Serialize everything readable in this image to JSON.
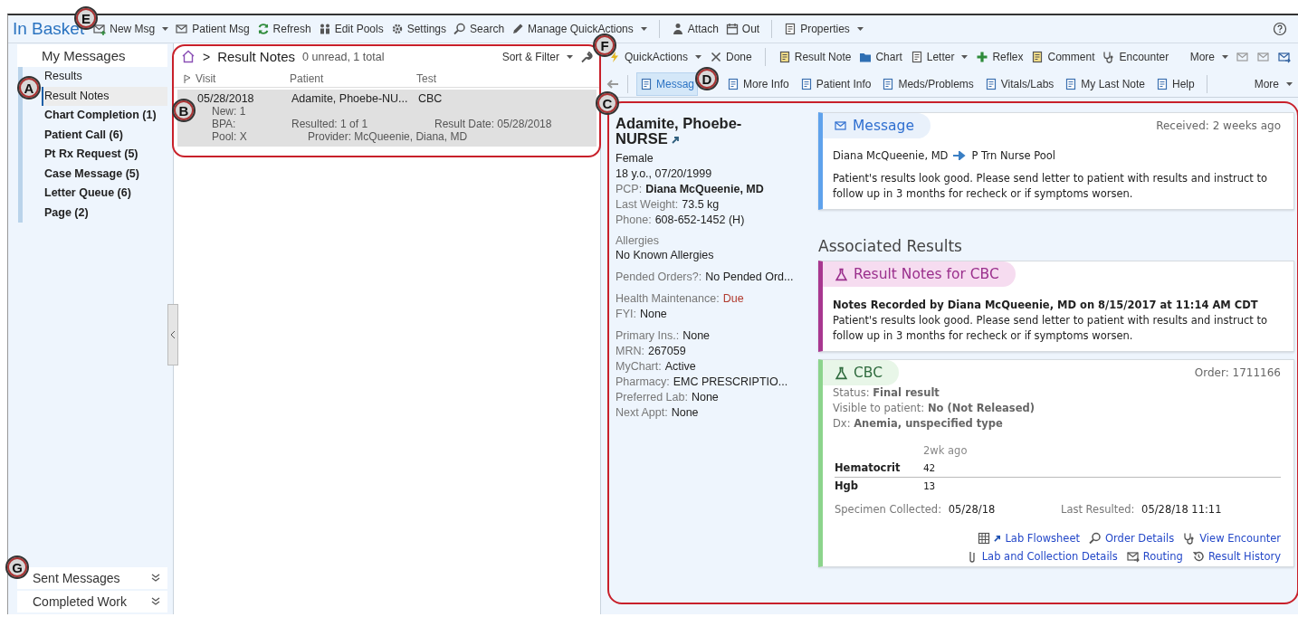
{
  "toolbar": {
    "title": "In Basket",
    "groups": [
      [
        {
          "label": "New Msg",
          "dropdown": true
        },
        {
          "label": "Patient Msg",
          "dropdown": false
        },
        {
          "label": "Refresh",
          "dropdown": false
        },
        {
          "label": "Edit Pools",
          "dropdown": false
        },
        {
          "label": "Settings",
          "dropdown": false
        },
        {
          "label": "Search",
          "dropdown": false
        },
        {
          "label": "Manage QuickActions",
          "dropdown": true
        }
      ],
      [
        {
          "label": "Attach",
          "dropdown": false
        },
        {
          "label": "Out",
          "dropdown": false
        }
      ],
      [
        {
          "label": "Properties",
          "dropdown": true
        }
      ]
    ]
  },
  "sidebar": {
    "title": "My Messages",
    "items": [
      {
        "label": "Results",
        "unread": false,
        "selected": false
      },
      {
        "label": "Result Notes",
        "unread": false,
        "selected": true
      },
      {
        "label": "Chart Completion (1)",
        "unread": true,
        "selected": false
      },
      {
        "label": "Patient Call (6)",
        "unread": true,
        "selected": false
      },
      {
        "label": "Pt Rx Request (5)",
        "unread": true,
        "selected": false
      },
      {
        "label": "Case Message (5)",
        "unread": true,
        "selected": false
      },
      {
        "label": "Letter Queue (6)",
        "unread": true,
        "selected": false
      },
      {
        "label": "Page (2)",
        "unread": true,
        "selected": false
      }
    ],
    "footer": [
      {
        "label": "Sent Messages"
      },
      {
        "label": "Completed Work"
      }
    ]
  },
  "message_list": {
    "separator": ">",
    "folder": "Result Notes",
    "summary": "0 unread, 1 total",
    "sort_filter": "Sort & Filter",
    "columns": [
      "Visit",
      "Patient",
      "Test"
    ],
    "rows": [
      {
        "selected": true,
        "visit": "05/28/2018",
        "patient": "Adamite, Phoebe-NU...",
        "test": "CBC",
        "details": [
          [
            "New: 1"
          ],
          [
            "BPA:",
            "Resulted: 1 of 1",
            "Result Date: 05/28/2018"
          ],
          [
            "Pool: X",
            "Provider: McQueenie, Diana, MD"
          ]
        ]
      }
    ]
  },
  "actions": {
    "groups": [
      [
        {
          "label": "QuickActions",
          "dropdown": true
        },
        {
          "label": "Done",
          "dropdown": false
        }
      ],
      [
        {
          "label": "Result Note",
          "dropdown": false
        },
        {
          "label": "Chart",
          "dropdown": false
        },
        {
          "label": "Letter",
          "dropdown": true
        },
        {
          "label": "Reflex",
          "dropdown": false
        },
        {
          "label": "Comment",
          "dropdown": false
        },
        {
          "label": "Encounter",
          "dropdown": false
        }
      ]
    ],
    "more": "More"
  },
  "tabs": {
    "items": [
      {
        "label": "Messag",
        "selected": true
      },
      {
        "label": "More Info",
        "selected": false
      },
      {
        "label": "Patient Info",
        "selected": false
      },
      {
        "label": "Meds/Problems",
        "selected": false
      },
      {
        "label": "Vitals/Labs",
        "selected": false
      },
      {
        "label": "My Last Note",
        "selected": false
      },
      {
        "label": "Help",
        "selected": false
      }
    ],
    "more": "More"
  },
  "patient": {
    "name": "Adamite, Phoebe-NURSE",
    "groups": [
      [
        {
          "kind": "plain",
          "value": "Female"
        },
        {
          "kind": "plain",
          "value": "18 y.o., 07/20/1999"
        },
        {
          "kind": "bold",
          "label": "PCP:",
          "value": "Diana McQueenie, MD"
        },
        {
          "kind": "plain",
          "label": "Last Weight:",
          "value": "73.5 kg"
        },
        {
          "kind": "plain",
          "label": "Phone:",
          "value": "608-652-1452 (H)"
        }
      ],
      [
        {
          "kind": "stacked",
          "label": "Allergies",
          "value": "No Known Allergies"
        }
      ],
      [
        {
          "kind": "plain",
          "label": "Pended Orders?:",
          "value": "No Pended Ord..."
        }
      ],
      [
        {
          "kind": "alert",
          "label": "Health Maintenance:",
          "value": "Due"
        },
        {
          "kind": "plain",
          "label": "FYI:",
          "value": "None"
        }
      ],
      [
        {
          "kind": "plain",
          "label": "Primary Ins.:",
          "value": "None"
        },
        {
          "kind": "plain",
          "label": "MRN:",
          "value": "267059"
        },
        {
          "kind": "plain",
          "label": "MyChart:",
          "value": "Active"
        },
        {
          "kind": "plain",
          "label": "Pharmacy:",
          "value": "EMC PRESCRIPTIO..."
        },
        {
          "kind": "plain",
          "label": "Preferred Lab:",
          "value": "None"
        },
        {
          "kind": "plain",
          "label": "Next Appt:",
          "value": "None"
        }
      ]
    ]
  },
  "message_card": {
    "title": "Message",
    "received": "Received: 2 weeks ago",
    "from": "Diana McQueenie, MD",
    "to": "P Trn Nurse Pool",
    "body": "Patient's results look good. Please send letter to patient with results and instruct to follow up in 3 months for recheck or if symptoms worsen."
  },
  "associated_heading": "Associated Results",
  "result_notes_card": {
    "title": "Result Notes for CBC",
    "header": "Notes Recorded by Diana McQueenie, MD on 8/15/2017 at 11:14 AM CDT",
    "body": "Patient's results look good. Please send letter to patient with results and instruct to follow up in 3 months for recheck or if symptoms worsen."
  },
  "order_card": {
    "title": "CBC",
    "order": "Order: 1711166",
    "facts": [
      {
        "label": "Status:",
        "value": "Final result"
      },
      {
        "label": "Visible to patient:",
        "value": "No (Not Released)"
      },
      {
        "label": "Dx:",
        "value": "Anemia, unspecified type"
      }
    ],
    "column": "2wk ago",
    "results": [
      {
        "name": "Hematocrit",
        "value": "42"
      },
      {
        "name": "Hgb",
        "value": "13"
      }
    ],
    "collected": {
      "label": "Specimen Collected:",
      "value": "05/28/18"
    },
    "resulted": {
      "label": "Last Resulted:",
      "value": "05/28/18 11:11"
    },
    "links": [
      [
        "Lab Flowsheet",
        "Order Details",
        "View Encounter"
      ],
      [
        "Lab and Collection Details",
        "Routing",
        "Result History"
      ]
    ]
  },
  "callouts": [
    {
      "letter": "A"
    },
    {
      "letter": "B"
    },
    {
      "letter": "C"
    },
    {
      "letter": "D"
    },
    {
      "letter": "E"
    },
    {
      "letter": "F"
    },
    {
      "letter": "G"
    }
  ]
}
